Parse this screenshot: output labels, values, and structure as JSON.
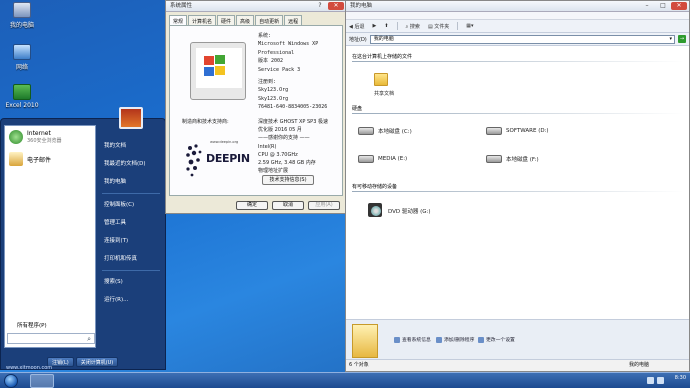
{
  "desktop": {
    "icons": [
      {
        "name": "computer-icon",
        "label": "我的电脑"
      },
      {
        "name": "network-icon",
        "label": "网络"
      },
      {
        "name": "excel-icon",
        "label": "Excel 2010"
      }
    ]
  },
  "start_menu": {
    "pinned": [
      {
        "title": "Internet",
        "subtitle": "360安全浏览器"
      },
      {
        "title": "电子邮件",
        "subtitle": ""
      }
    ],
    "all_programs": "所有程序(P)",
    "right_items": [
      "我的文档",
      "我最近的文档(D)",
      "我的电脑",
      "控制面板(C)",
      "管理工具",
      "连接到(T)",
      "打印机和传真",
      "搜索(S)",
      "运行(R)..."
    ],
    "bottom": {
      "logoff": "注销(L)",
      "shutdown": "关闭计算机(U)"
    }
  },
  "system_properties": {
    "title": "系统属性",
    "tabs": [
      "常规",
      "计算机名",
      "硬件",
      "高级",
      "自动更新",
      "远程"
    ],
    "system_label": "系统:",
    "system_lines": [
      "Microsoft Windows XP",
      "Professional",
      "版本 2002",
      "Service Pack 3"
    ],
    "registered_label": "注册到:",
    "registered_lines": [
      "Sky123.Org",
      "Sky123.Org",
      "76481-640-8834005-23026"
    ],
    "manufacturer_label": "制造商和技术支持商:",
    "manufacturer_lines": [
      "深度技术 GHOST XP SP3 极速",
      "优化版 2016 05 月",
      "——感谢你的支持 ——",
      "Intel(R)",
      "CPU @ 3.70GHz",
      "2.59 GHz, 3.48 GB 内存",
      "物理地址扩展"
    ],
    "support_button": "技术支持信息(S)",
    "logo": {
      "url": "www.deepin.org",
      "word": "DEEPIN"
    },
    "buttons": [
      "确定",
      "取消",
      "应用(A)"
    ]
  },
  "my_computer": {
    "title": "我的电脑",
    "nav": {
      "back": "后退",
      "search": "搜索",
      "folders": "文件夹"
    },
    "address_label": "地址(D)",
    "address_value": "我的电脑",
    "go_label": "→",
    "section_stored": "在这台计算机上存储的文件",
    "shared_docs": "共享文档",
    "section_hdd": "硬盘",
    "drives": [
      "本地磁盘 (C:)",
      "SOFTWARE (D:)",
      "MEDIA (E:)",
      "本地磁盘 (F:)"
    ],
    "section_removable": "有可移动存储的设备",
    "dvd": "DVD 驱动器 (G:)",
    "tasks": [
      "查看系统信息",
      "添加/删除程序",
      "更改一个设置"
    ],
    "status_left": "6 个对象",
    "status_right": "我的电脑"
  },
  "taskbar": {
    "clock": "8:30"
  },
  "watermark": "www.xitmoon.com"
}
